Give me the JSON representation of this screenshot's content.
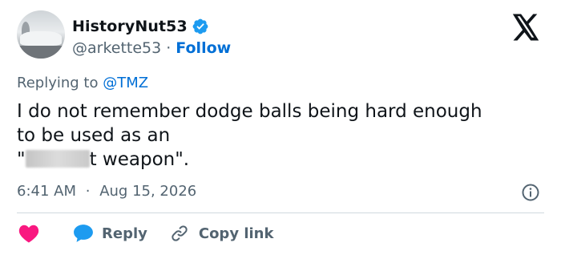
{
  "user": {
    "display_name": "HistoryNut53",
    "handle": "@arkette53",
    "separator": "·",
    "follow_label": "Follow",
    "verified_color": "#1d9bf0"
  },
  "reply_context": {
    "prefix": "Replying to",
    "mention": "@TMZ"
  },
  "tweet": {
    "line1": "I do not remember dodge balls being hard enough",
    "line2": "to be used as an",
    "line3_open": "\"",
    "line3_rest": "t weapon\"."
  },
  "meta": {
    "time": "6:41 AM",
    "separator": "·",
    "date": "Aug 15, 2026"
  },
  "actions": {
    "reply_label": "Reply",
    "copy_label": "Copy link",
    "like_color": "#f91880",
    "reply_color": "#1d9bf0"
  },
  "icons": [
    "verified-badge-icon",
    "x-logo-icon",
    "info-icon",
    "heart-icon",
    "reply-bubble-icon",
    "link-icon"
  ]
}
